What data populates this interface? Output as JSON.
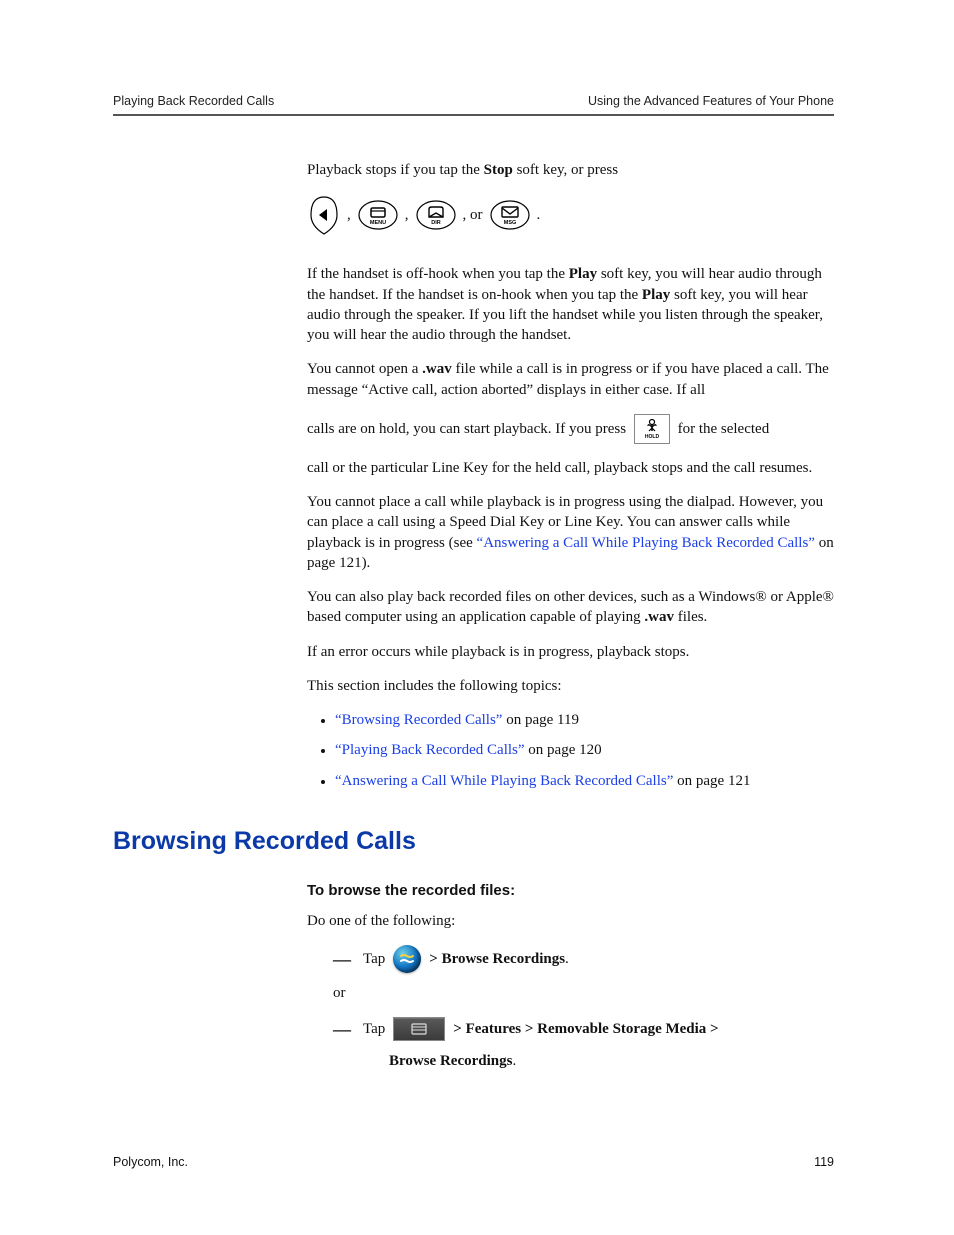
{
  "header": {
    "left": "Playing Back Recorded Calls",
    "right": "Using the Advanced Features of Your Phone"
  },
  "p1": {
    "pre": "Playback stops if you tap the ",
    "stop": "Stop",
    "post": " soft key, or press "
  },
  "icon_line": {
    "or": "or",
    "comma": ","
  },
  "p2": {
    "t1": "If the handset is off-hook when you tap the ",
    "play1": "Play",
    "t2": " soft key, you will hear audio through the handset. If the handset is on-hook when you tap the ",
    "play2": "Play",
    "t3": " soft key, you will hear audio through the speaker. If you lift the handset while you listen through the speaker, you will hear the audio through the handset."
  },
  "p3": {
    "t1": "You cannot open a ",
    "wav": ".wav",
    "t2": " file while a call is in progress or if you have placed a call. The message “Active call, action aborted” displays in either case. If all "
  },
  "p4": {
    "t1": "calls are on hold, you can start playback. If you press ",
    "t2": " for the selected "
  },
  "p5": "call or the particular Line Key for the held call, playback stops and the call resumes.",
  "p6": {
    "t1": "You cannot place a call while playback is in progress using the dialpad. However, you can place a call using a Speed Dial Key or Line Key. You can answer calls while playback is in progress (see ",
    "link": "“Answering a Call While Playing Back Recorded Calls”",
    "t2": " on page 121)."
  },
  "p7": {
    "t1": "You can also play back recorded files on other devices, such as a Windows® or Apple® based computer using an application capable of playing ",
    "wav": ".wav",
    "t2": " files."
  },
  "p8": "If an error occurs while playback is in progress, playback stops.",
  "p9": "This section includes the following topics:",
  "topics": [
    {
      "link": "“Browsing Recorded Calls”",
      "tail": " on page 119"
    },
    {
      "link": "“Playing Back Recorded Calls”",
      "tail": " on page 120"
    },
    {
      "link": "“Answering a Call While Playing Back Recorded Calls”",
      "tail": " on page 121"
    }
  ],
  "section_title": "Browsing Recorded Calls",
  "subhead": "To browse the recorded files:",
  "do_one": "Do one of the following:",
  "step_a": {
    "tap": "Tap ",
    "tail_bold": " > Browse Recordings",
    "period": "."
  },
  "or": "or",
  "step_b": {
    "tap": "Tap ",
    "tail_bold_1": " > Features > Removable Storage Media > ",
    "tail_bold_2": "Browse Recordings",
    "period": "."
  },
  "footer": {
    "left": "Polycom, Inc.",
    "right": "119"
  }
}
